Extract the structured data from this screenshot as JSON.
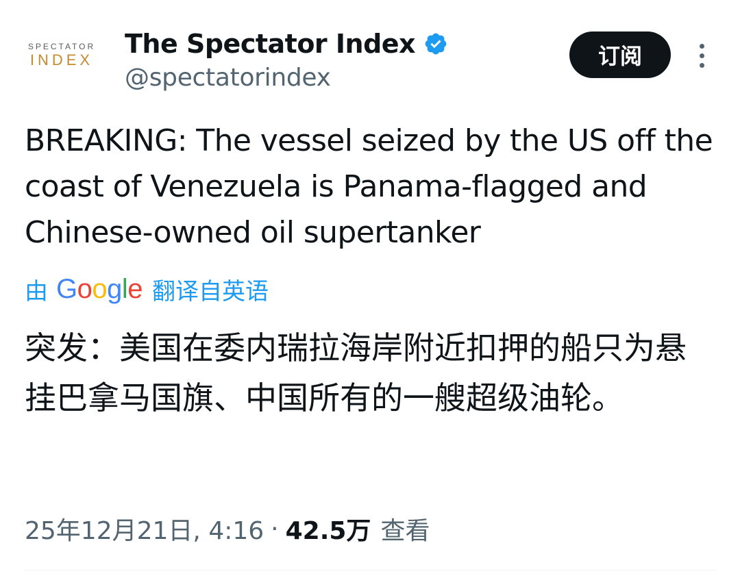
{
  "author": {
    "avatar_line1": "SPECTATOR",
    "avatar_line2": "INDEX",
    "display_name": "The Spectator Index",
    "handle": "@spectatorindex",
    "verified": true
  },
  "actions": {
    "subscribe_label": "订阅",
    "more_icon": "more-vertical-icon"
  },
  "tweet": {
    "text": "BREAKING: The vessel seized by the US off the coast of Venezuela is Panama-flagged and Chinese-owned oil supertanker",
    "translate_by": "由",
    "translate_brand": "Google",
    "translate_from": "翻译自英语",
    "translated_text": "突发：美国在委内瑞拉海岸附近扣押的船只为悬挂巴拿马国旗、中国所有的一艘超级油轮。"
  },
  "meta": {
    "timestamp": "25年12月21日, 4:16",
    "separator": "·",
    "views_count": "42.5万",
    "views_label": "查看"
  },
  "colors": {
    "text_primary": "#0f1419",
    "text_secondary": "#536471",
    "link_blue": "#1d9bf0",
    "verified_blue": "#1d9bf0",
    "avatar_gold": "#c48a2e"
  }
}
